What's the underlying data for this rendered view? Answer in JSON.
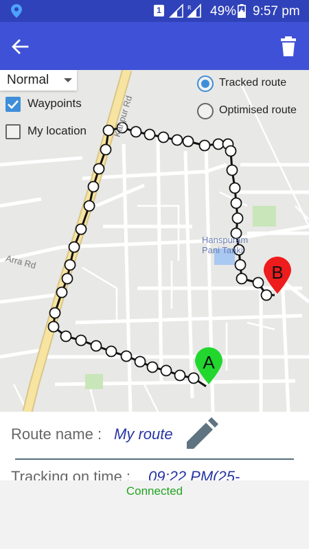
{
  "status_bar": {
    "sim_slot": "1",
    "battery": "49%",
    "time": "9:57 pm"
  },
  "map": {
    "map_type": "Normal",
    "waypoints_label": "Waypoints",
    "waypoints_checked": true,
    "my_location_label": "My location",
    "my_location_checked": false,
    "tracked_route_label": "Tracked route",
    "optimised_route_label": "Optimised route",
    "selected_route": "Tracked route",
    "street_labels": [
      "Arra Rd",
      "Hanspuram Pani Tanki",
      "Kanpur Rd"
    ],
    "marker_start": "A",
    "marker_end": "B",
    "colors": {
      "marker_start": "#21d72e",
      "marker_end": "#ee1c1c",
      "route": "#111111",
      "highway": "#f7e4a0"
    }
  },
  "route": {
    "name_label": "Route name : ",
    "name_value": "My route",
    "tracking_label": "Tracking on time : ",
    "tracking_value": "09:22 PM(25-"
  },
  "footer": {
    "connection_status": "Connected"
  },
  "colors": {
    "app_bar": "#3f51d6",
    "status_bar": "#2f42b9",
    "accent": "#3f8ed9",
    "connected": "#21a321"
  }
}
